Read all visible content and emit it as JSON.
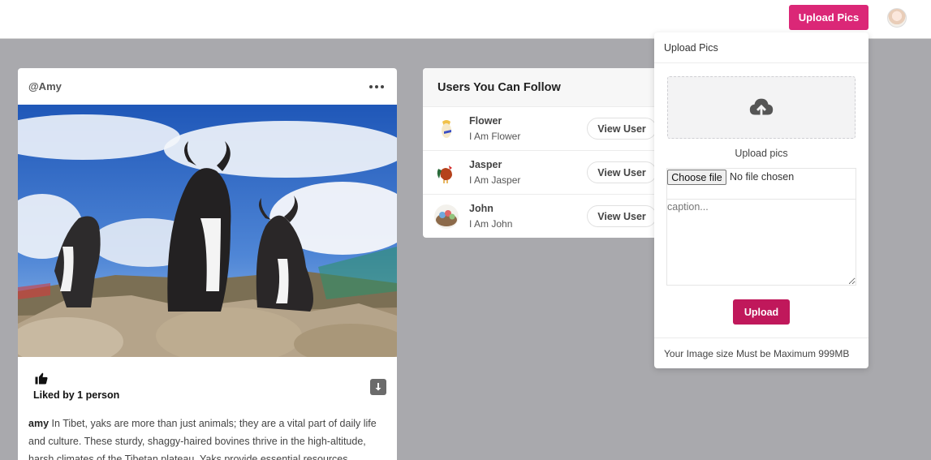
{
  "header": {
    "upload_button_label": "Upload Pics",
    "avatar_icon": "user-avatar",
    "accent_color": "#db2777"
  },
  "post": {
    "username": "@Amy",
    "menu_icon": "more-dots-icon",
    "image_description_icon": "post-image",
    "like_icon": "thumbs-up-icon",
    "liked_text": "Liked by 1 person",
    "download_icon": "download-icon",
    "caption_author": "amy",
    "caption_text": "In Tibet, yaks are more than just animals; they are a vital part of daily life and culture. These sturdy, shaggy-haired bovines thrive in the high-altitude, harsh climates of the Tibetan plateau. Yaks provide essential resources"
  },
  "follow": {
    "title": "Users You Can Follow",
    "users": [
      {
        "name": "Flower",
        "bio": "I Am Flower",
        "button": "View User"
      },
      {
        "name": "Jasper",
        "bio": "I Am Jasper",
        "button": "View User"
      },
      {
        "name": "John",
        "bio": "I Am John",
        "button": "View User"
      }
    ]
  },
  "upload_panel": {
    "title": "Upload Pics",
    "dropzone_icon": "cloud-upload-icon",
    "dropzone_label": "Upload pics",
    "choose_file_label": "Choose file",
    "no_file_text": "No file chosen",
    "caption_placeholder": "caption...",
    "upload_button_label": "Upload",
    "footer_note": "Your Image size Must be Maximum 999MB",
    "button_color": "#c0185b"
  }
}
